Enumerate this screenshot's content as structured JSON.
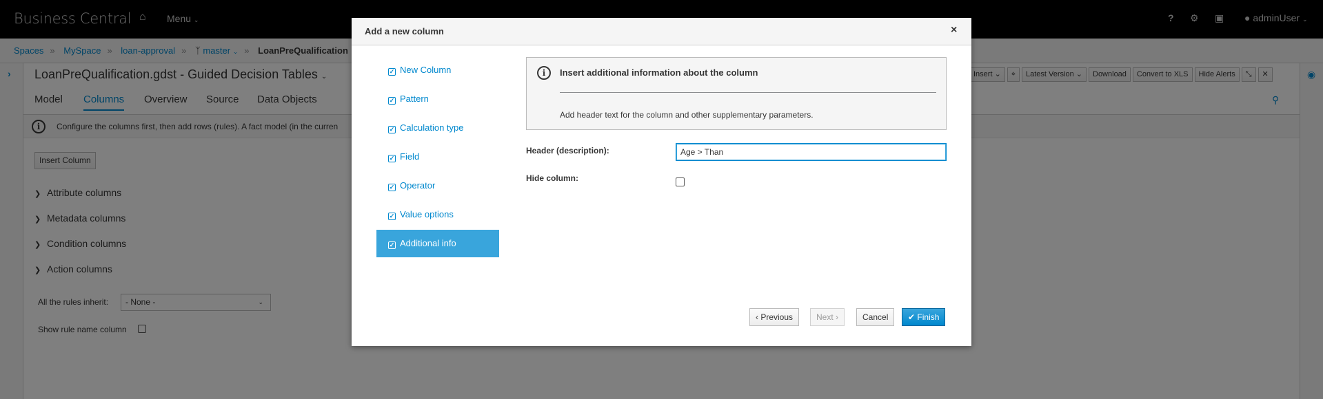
{
  "navbar": {
    "brand": "Business Central",
    "home_icon": "home-icon",
    "menu_label": "Menu",
    "help_label": "?",
    "gear_icon": "gear-icon",
    "briefcase_icon": "briefcase-icon",
    "user_label": "adminUser"
  },
  "breadcrumb": {
    "items": [
      "Spaces",
      "MySpace",
      "loan-approval",
      "master"
    ],
    "current": "LoanPreQualification"
  },
  "editor": {
    "title": "LoanPreQualification.gdst - Guided Decision Tables",
    "tabs": [
      "Model",
      "Columns",
      "Overview",
      "Source",
      "Data Objects"
    ],
    "active_tab": "Columns",
    "toolbar": [
      "Insert",
      "Latest Version",
      "Download",
      "Convert to XLS",
      "Hide Alerts"
    ],
    "info_text": "Configure the columns first, then add rows (rules). A fact model (in the curren",
    "insert_column_label": "Insert Column",
    "sections": [
      "Attribute columns",
      "Metadata columns",
      "Condition columns",
      "Action columns"
    ],
    "inherit_label": "All the rules inherit:",
    "inherit_value": "- None -",
    "rule_name_label": "Show rule name column"
  },
  "modal": {
    "title": "Add a new column",
    "close_label": "×",
    "steps": [
      "New Column",
      "Pattern",
      "Calculation type",
      "Field",
      "Operator",
      "Value options",
      "Additional info"
    ],
    "active_step": "Additional info",
    "info_title": "Insert additional information about the column",
    "info_text": "Add header text for the column and other supplementary parameters.",
    "header_label": "Header (description):",
    "header_value": "Age > Than",
    "hide_label": "Hide column:",
    "hide_checked": false,
    "buttons": {
      "previous": "Previous",
      "next": "Next",
      "cancel": "Cancel",
      "finish": "Finish"
    }
  },
  "colors": {
    "accent": "#0088ce",
    "active_step": "#39a5dc",
    "navbar": "#000000"
  }
}
